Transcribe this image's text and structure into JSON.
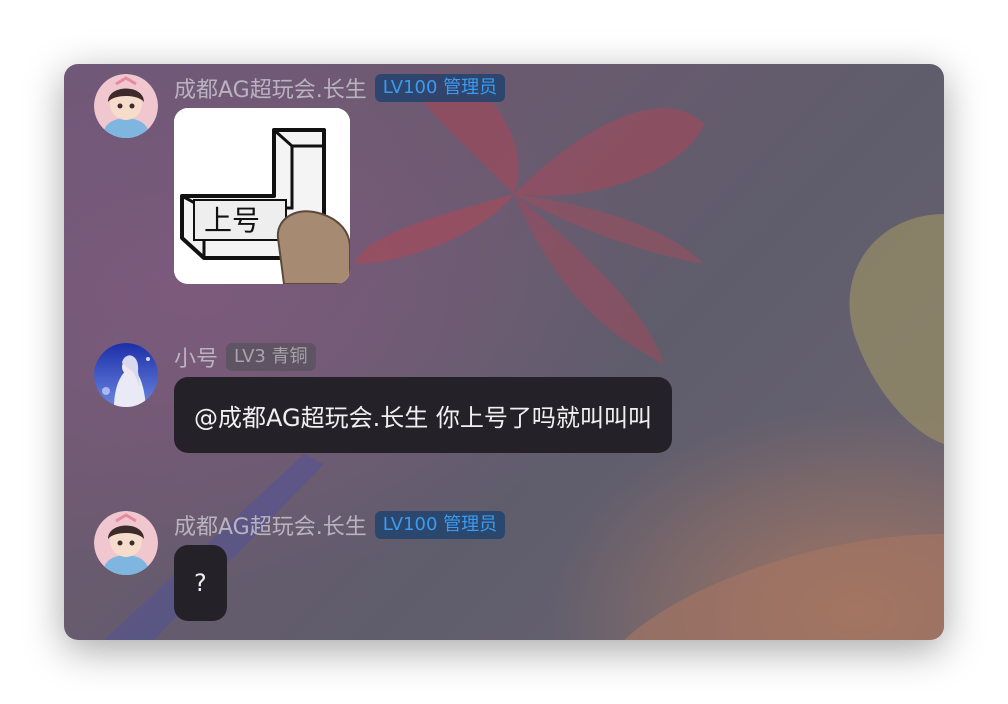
{
  "messages": [
    {
      "username": "成都AG超玩会.长生",
      "badge": "LV100 管理员",
      "type": "sticker",
      "sticker_text": "上号"
    },
    {
      "username": "小号",
      "badge": "LV3 青铜",
      "type": "text",
      "text": "@成都AG超玩会.长生 你上号了吗就叫叫叫"
    },
    {
      "username": "成都AG超玩会.长生",
      "badge": "LV100 管理员",
      "type": "text",
      "text": "?"
    }
  ],
  "colors": {
    "admin_badge_text": "#3a9bf0",
    "bronze_badge_text": "#a8a2ac",
    "bubble_bg": "#242228"
  }
}
